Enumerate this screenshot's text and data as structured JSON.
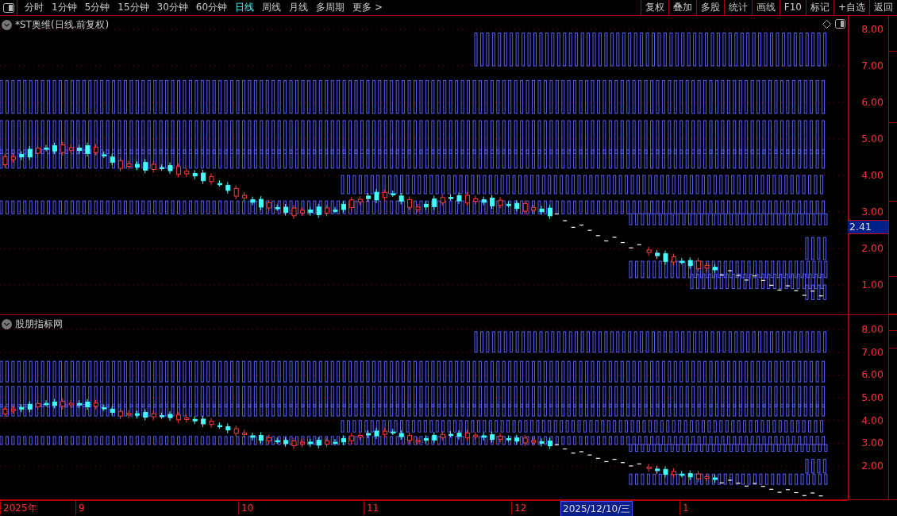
{
  "toolbar": {
    "periods": [
      {
        "label": "分时",
        "selected": false
      },
      {
        "label": "1分钟",
        "selected": false
      },
      {
        "label": "5分钟",
        "selected": false
      },
      {
        "label": "15分钟",
        "selected": false
      },
      {
        "label": "30分钟",
        "selected": false
      },
      {
        "label": "60分钟",
        "selected": false
      },
      {
        "label": "日线",
        "selected": true
      },
      {
        "label": "周线",
        "selected": false
      },
      {
        "label": "月线",
        "selected": false
      },
      {
        "label": "多周期",
        "selected": false
      },
      {
        "label": "更多 >",
        "selected": false
      }
    ],
    "buttons": [
      "复权",
      "叠加",
      "多股",
      "统计",
      "画线",
      "F10",
      "标记",
      "+自选",
      "返回"
    ]
  },
  "main_pane": {
    "title": "*ST奥维(日线.前复权)",
    "y_ticks": [
      "8.00",
      "7.00",
      "6.00",
      "5.00",
      "4.00",
      "3.00",
      "2.00",
      "1.00"
    ],
    "last_price": "2.41"
  },
  "indicator_pane": {
    "title": "股朋指标网",
    "y_ticks": [
      "8.00",
      "7.00",
      "6.00",
      "5.00",
      "4.00",
      "3.00",
      "2.00"
    ]
  },
  "date_axis": {
    "labels": [
      {
        "text": "2025年",
        "highlighted": false
      },
      {
        "text": "9",
        "highlighted": false
      },
      {
        "text": "10",
        "highlighted": false
      },
      {
        "text": "11",
        "highlighted": false
      },
      {
        "text": "12",
        "highlighted": false
      },
      {
        "text": "2025/12/10/三",
        "highlighted": true
      },
      {
        "text": "1",
        "highlighted": false
      }
    ]
  }
}
